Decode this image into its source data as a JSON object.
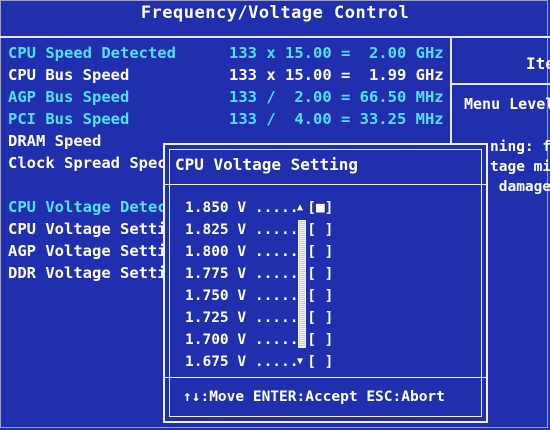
{
  "title": "Frequency/Voltage Control",
  "settings": [
    {
      "label": "CPU Speed Detected",
      "value": "133 x 15.00 =  2.00 GHz",
      "color": "cyan"
    },
    {
      "label": "CPU Bus Speed",
      "value": "133 x 15.00 =  1.99 GHz",
      "color": "white"
    },
    {
      "label": "AGP Bus Speed",
      "value": "133 /  2.00 = 66.50 MHz",
      "color": "cyan"
    },
    {
      "label": "PCI Bus Speed",
      "value": "133 /  4.00 = 33.25 MHz",
      "color": "cyan"
    },
    {
      "label": "DRAM Speed",
      "value": "",
      "color": "white"
    },
    {
      "label": "Clock Spread Spec",
      "value": "",
      "color": "white"
    },
    {
      "label": "CPU Voltage Detec",
      "value": "",
      "color": "cyan"
    },
    {
      "label": "CPU Voltage Setti",
      "value": "",
      "color": "white"
    },
    {
      "label": "AGP Voltage Setti",
      "value": "",
      "color": "white"
    },
    {
      "label": "DDR Voltage Setti",
      "value": "",
      "color": "white"
    }
  ],
  "help_panel": {
    "header": "Ite",
    "menu_level": "Menu Level",
    "warning_lines": [
      "ning: f",
      "tage mi",
      " damage"
    ]
  },
  "popup": {
    "title": "CPU Voltage Setting",
    "options": [
      {
        "text": "1.850 V ..... [■]",
        "selected": true
      },
      {
        "text": "1.825 V ..... [ ]",
        "selected": false
      },
      {
        "text": "1.800 V ..... [ ]",
        "selected": false
      },
      {
        "text": "1.775 V ..... [ ]",
        "selected": false
      },
      {
        "text": "1.750 V ..... [ ]",
        "selected": false
      },
      {
        "text": "1.725 V ..... [ ]",
        "selected": false
      },
      {
        "text": "1.700 V ..... [ ]",
        "selected": false
      },
      {
        "text": "1.675 V ..... [ ]",
        "selected": false
      }
    ],
    "scroll_up": "▲",
    "scroll_down": "▼",
    "footer": "↑↓:Move ENTER:Accept ESC:Abort"
  },
  "colors": {
    "background": "#1f2fae",
    "cyan": "#55e0ff",
    "white": "#ffffff"
  }
}
